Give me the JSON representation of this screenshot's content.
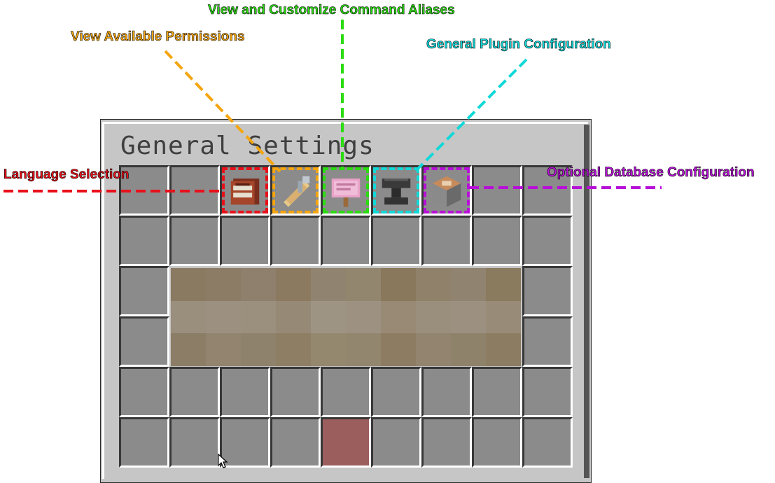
{
  "window": {
    "title": "General Settings"
  },
  "items": {
    "language": "book-icon",
    "permissions": "paper-key-icon",
    "aliases": "name-tag-icon",
    "plugin_config": "anvil-icon",
    "database": "command-block-icon"
  },
  "annotations": [
    {
      "key": "language",
      "label": "Language Selection",
      "color": "#e8101a"
    },
    {
      "key": "permissions",
      "label": "View Available Permissions",
      "color": "#f5a50f"
    },
    {
      "key": "aliases",
      "label": "View and Customize Command Aliases",
      "color": "#2bdc10"
    },
    {
      "key": "plugin_config",
      "label": "General Plugin Configuration",
      "color": "#12d8d8"
    },
    {
      "key": "database",
      "label": "Optional Database Configuration",
      "color": "#b80fd8"
    }
  ]
}
